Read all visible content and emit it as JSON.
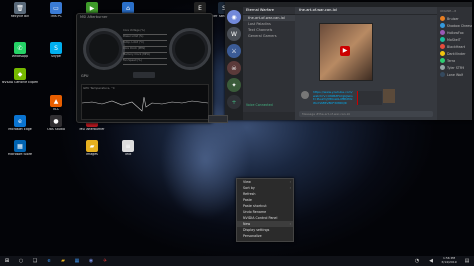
{
  "desktop": {
    "icons": [
      {
        "name": "recycle-bin",
        "label": "Recycle Bin",
        "glyph": "🗑",
        "color": "#5a6a7a"
      },
      {
        "name": "this-pc",
        "label": "This PC",
        "glyph": "▭",
        "color": "#3a7bd5"
      },
      {
        "name": "geforce",
        "label": "GeForce Experience",
        "glyph": "▶",
        "color": "#3e9b2a"
      },
      {
        "name": "network",
        "label": "Network",
        "glyph": "⌂",
        "color": "#2a6fc9"
      },
      {
        "name": "epic",
        "label": "Epic Games Launcher",
        "glyph": "E",
        "color": "#222"
      },
      {
        "name": "steam",
        "label": "Steam",
        "glyph": "S",
        "color": "#1b2838"
      },
      {
        "name": "whatsapp",
        "label": "WhatsApp",
        "glyph": "✆",
        "color": "#25d366"
      },
      {
        "name": "skype",
        "label": "Skype",
        "glyph": "S",
        "color": "#00aff0"
      },
      {
        "name": "kakao",
        "label": "KakaoTalk",
        "glyph": "K",
        "color": "#2b2b2b"
      },
      {
        "name": "nvidia",
        "label": "NVIDIA GeForce Experience",
        "glyph": "◆",
        "color": "#76b900"
      },
      {
        "name": "vlc",
        "label": "VLC",
        "glyph": "▲",
        "color": "#e85e00"
      },
      {
        "name": "ccleaner",
        "label": "CCleaner",
        "glyph": "C",
        "color": "#c0392b"
      },
      {
        "name": "edge",
        "label": "Microsoft Edge",
        "glyph": "e",
        "color": "#0a74d1"
      },
      {
        "name": "obs",
        "label": "OBS Studio",
        "glyph": "●",
        "color": "#302e31"
      },
      {
        "name": "msi",
        "label": "MSI Afterburner",
        "glyph": "✈",
        "color": "#b0171f"
      },
      {
        "name": "ms-store",
        "label": "Microsoft Store",
        "glyph": "▦",
        "color": "#0063b1"
      },
      {
        "name": "folder",
        "label": "Images",
        "glyph": "▰",
        "color": "#e6b020"
      },
      {
        "name": "text",
        "label": "Text",
        "glyph": "≡",
        "color": "#ddd"
      }
    ]
  },
  "afterburner": {
    "title": "MSI Afterburner",
    "version": "4.6.0",
    "labels": [
      "Core Voltage (%)",
      "Power Limit (%)",
      "Temp. Limit (°C)",
      "Core Clock (MHz)",
      "Memory Clock (MHz)",
      "Fan Speed (%)"
    ],
    "gpu_label": "GPU",
    "graph_label": "GPU Temperature, °C"
  },
  "discord": {
    "server_name": "Eternal Warfare",
    "active_channel": "the-art-of-war-can-lol",
    "channels": [
      "the-art-of-war-can-lol",
      "Lost Paladins",
      "Text Channels",
      "General Gamers"
    ],
    "connection": "Voice Connected",
    "message_link": "https://www.youtube.com/watch?v=Ut6BZFAYgbJ&list=PLs2mJY8KxsbL0fBt2MxWvYlAB5V8KF3X8DQR",
    "member_header": "ONLINE—8",
    "members": [
      "Bruiser",
      "Shadow Cheese",
      "HollowFox",
      "MoSkelT",
      "BlackHeart",
      "DarkVinder",
      "Terra",
      "Tyler STR9",
      "Lone Wolf"
    ],
    "message_placeholder": "Message #the-art-of-war-can-lol"
  },
  "context_menu": {
    "items": [
      "View",
      "Sort by",
      "Refresh",
      "Paste",
      "Paste shortcut",
      "Undo Rename",
      "NVIDIA Control Panel",
      "New",
      "Display settings",
      "Personalize"
    ]
  },
  "taskbar": {
    "time": "1:56 PM",
    "date": "3/14/2019"
  },
  "colors": {
    "discord_bg": "#36393f",
    "discord_side": "#2f3136",
    "discord_servers": "#202225",
    "blurple": "#7289da",
    "ab_dark": "#121416"
  }
}
